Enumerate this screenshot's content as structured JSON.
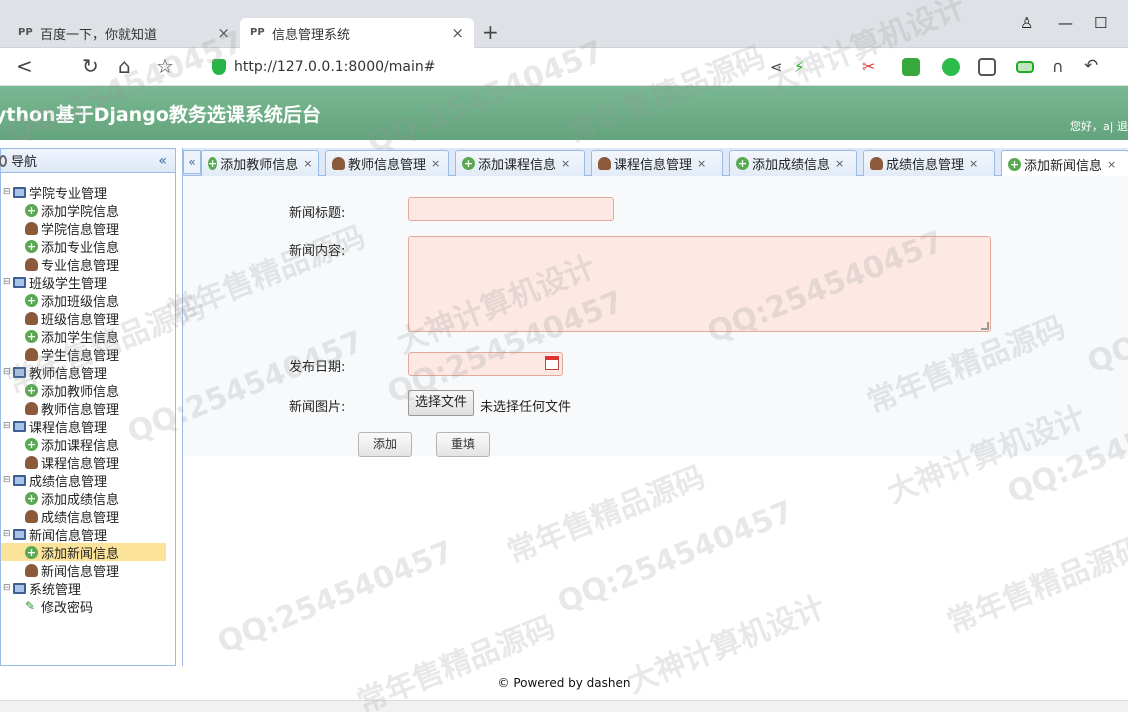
{
  "browser": {
    "tabs": [
      {
        "label": "百度一下，你就知道",
        "active": false
      },
      {
        "label": "信息管理系统",
        "active": true
      }
    ],
    "favicon_text": "PP",
    "url": "http://127.0.0.1:8000/main#"
  },
  "app": {
    "title": "ython基于Django教务选课系统后台",
    "welcome": "您好，a| 退"
  },
  "nav": {
    "title": "导航",
    "collapse_glyph": "«",
    "groups": [
      {
        "label": "学院专业管理",
        "items": [
          {
            "label": "添加学院信息",
            "icon": "add"
          },
          {
            "label": "学院信息管理",
            "icon": "user"
          },
          {
            "label": "添加专业信息",
            "icon": "add"
          },
          {
            "label": "专业信息管理",
            "icon": "user"
          }
        ]
      },
      {
        "label": "班级学生管理",
        "items": [
          {
            "label": "添加班级信息",
            "icon": "add"
          },
          {
            "label": "班级信息管理",
            "icon": "user"
          },
          {
            "label": "添加学生信息",
            "icon": "add"
          },
          {
            "label": "学生信息管理",
            "icon": "user"
          }
        ]
      },
      {
        "label": "教师信息管理",
        "items": [
          {
            "label": "添加教师信息",
            "icon": "add"
          },
          {
            "label": "教师信息管理",
            "icon": "user"
          }
        ]
      },
      {
        "label": "课程信息管理",
        "items": [
          {
            "label": "添加课程信息",
            "icon": "add"
          },
          {
            "label": "课程信息管理",
            "icon": "user"
          }
        ]
      },
      {
        "label": "成绩信息管理",
        "items": [
          {
            "label": "添加成绩信息",
            "icon": "add"
          },
          {
            "label": "成绩信息管理",
            "icon": "user"
          }
        ]
      },
      {
        "label": "新闻信息管理",
        "items": [
          {
            "label": "添加新闻信息",
            "icon": "add",
            "selected": true
          },
          {
            "label": "新闻信息管理",
            "icon": "user"
          }
        ]
      },
      {
        "label": "系统管理",
        "items": [
          {
            "label": "修改密码",
            "icon": "pen"
          }
        ]
      }
    ]
  },
  "tabs": [
    {
      "label": "添加教师信息",
      "icon": "add"
    },
    {
      "label": "教师信息管理",
      "icon": "user"
    },
    {
      "label": "添加课程信息",
      "icon": "add"
    },
    {
      "label": "课程信息管理",
      "icon": "user"
    },
    {
      "label": "添加成绩信息",
      "icon": "add"
    },
    {
      "label": "成绩信息管理",
      "icon": "user"
    },
    {
      "label": "添加新闻信息",
      "icon": "add",
      "active": true
    }
  ],
  "form": {
    "title_label": "新闻标题:",
    "title_value": "",
    "content_label": "新闻内容:",
    "content_value": "",
    "date_label": "发布日期:",
    "date_value": "",
    "image_label": "新闻图片:",
    "file_button": "选择文件",
    "file_status": "未选择任何文件",
    "submit_label": "添加",
    "reset_label": "重填"
  },
  "footer": "© Powered by dashen",
  "watermarks": [
    "QQ:254540457",
    "常年售精品源码",
    "大神计算机设计"
  ],
  "colors": {
    "header": "#6aaa82",
    "border": "#99bbe8",
    "input_bg": "#fde8e4",
    "selected": "#fbe49a"
  }
}
